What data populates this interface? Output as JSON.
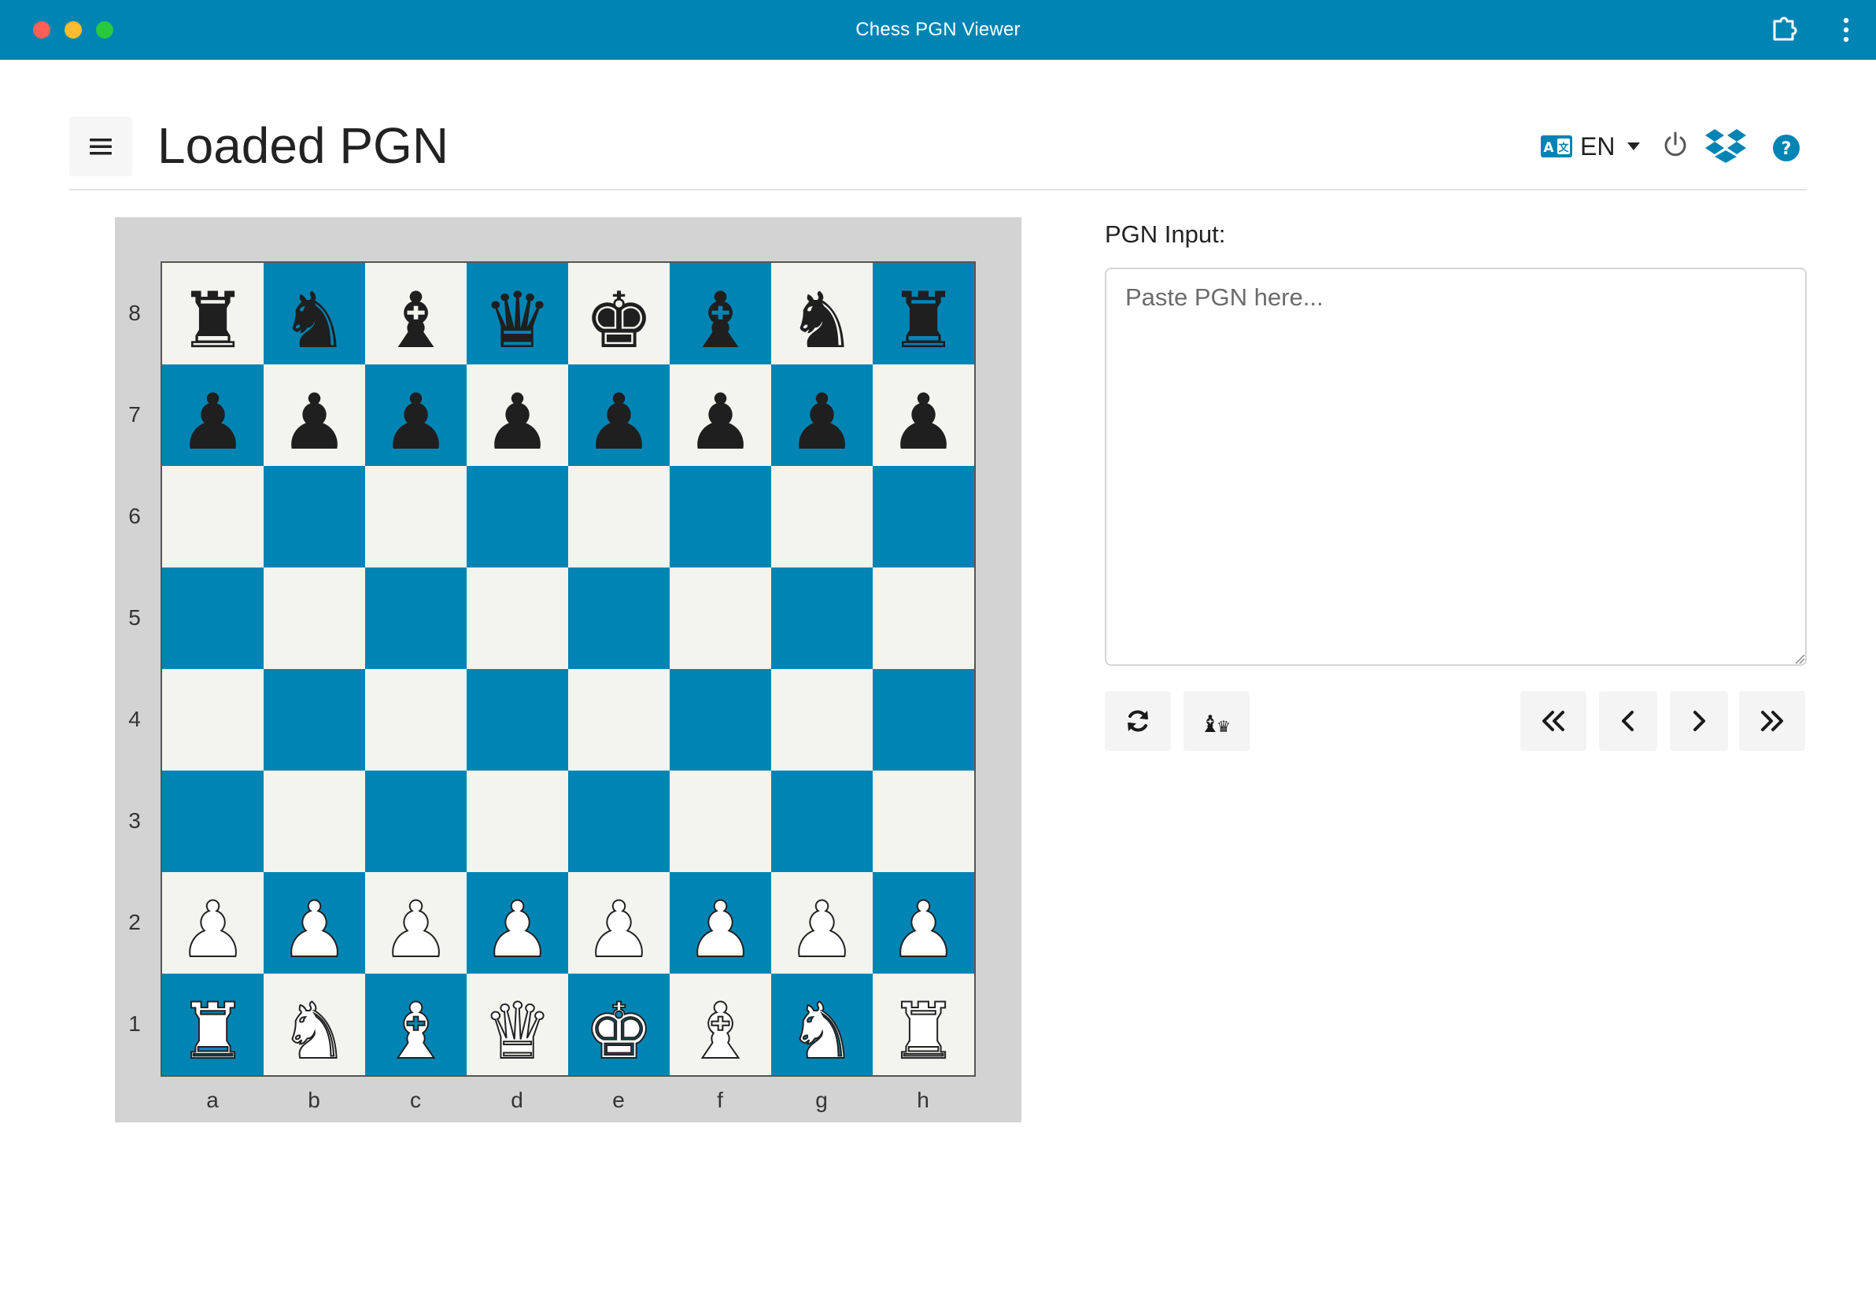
{
  "window": {
    "title": "Chess PGN Viewer"
  },
  "header": {
    "title": "Loaded PGN",
    "language": "EN"
  },
  "colors": {
    "brand": "#0084b4",
    "light_square": "#f4f4ef",
    "dark_square": "#0084b4"
  },
  "board": {
    "ranks": [
      "8",
      "7",
      "6",
      "5",
      "4",
      "3",
      "2",
      "1"
    ],
    "files": [
      "a",
      "b",
      "c",
      "d",
      "e",
      "f",
      "g",
      "h"
    ],
    "position": [
      [
        "♜",
        "♞",
        "♝",
        "♛",
        "♚",
        "♝",
        "♞",
        "♜"
      ],
      [
        "♟",
        "♟",
        "♟",
        "♟",
        "♟",
        "♟",
        "♟",
        "♟"
      ],
      [
        "",
        "",
        "",
        "",
        "",
        "",
        "",
        ""
      ],
      [
        "",
        "",
        "",
        "",
        "",
        "",
        "",
        ""
      ],
      [
        "",
        "",
        "",
        "",
        "",
        "",
        "",
        ""
      ],
      [
        "",
        "",
        "",
        "",
        "",
        "",
        "",
        ""
      ],
      [
        "♟",
        "♟",
        "♟",
        "♟",
        "♟",
        "♟",
        "♟",
        "♟"
      ],
      [
        "♜",
        "♞",
        "♝",
        "♛",
        "♚",
        "♝",
        "♞",
        "♜"
      ]
    ],
    "piece_colors": [
      "black",
      "black",
      "",
      "",
      "",
      "",
      "white",
      "white"
    ]
  },
  "pgn": {
    "label": "PGN Input:",
    "placeholder": "Paste PGN here...",
    "value": ""
  },
  "toolbar": {
    "icons": [
      "refresh-icon",
      "chess-pieces-icon",
      "first-move-icon",
      "previous-move-icon",
      "next-move-icon",
      "last-move-icon"
    ]
  }
}
